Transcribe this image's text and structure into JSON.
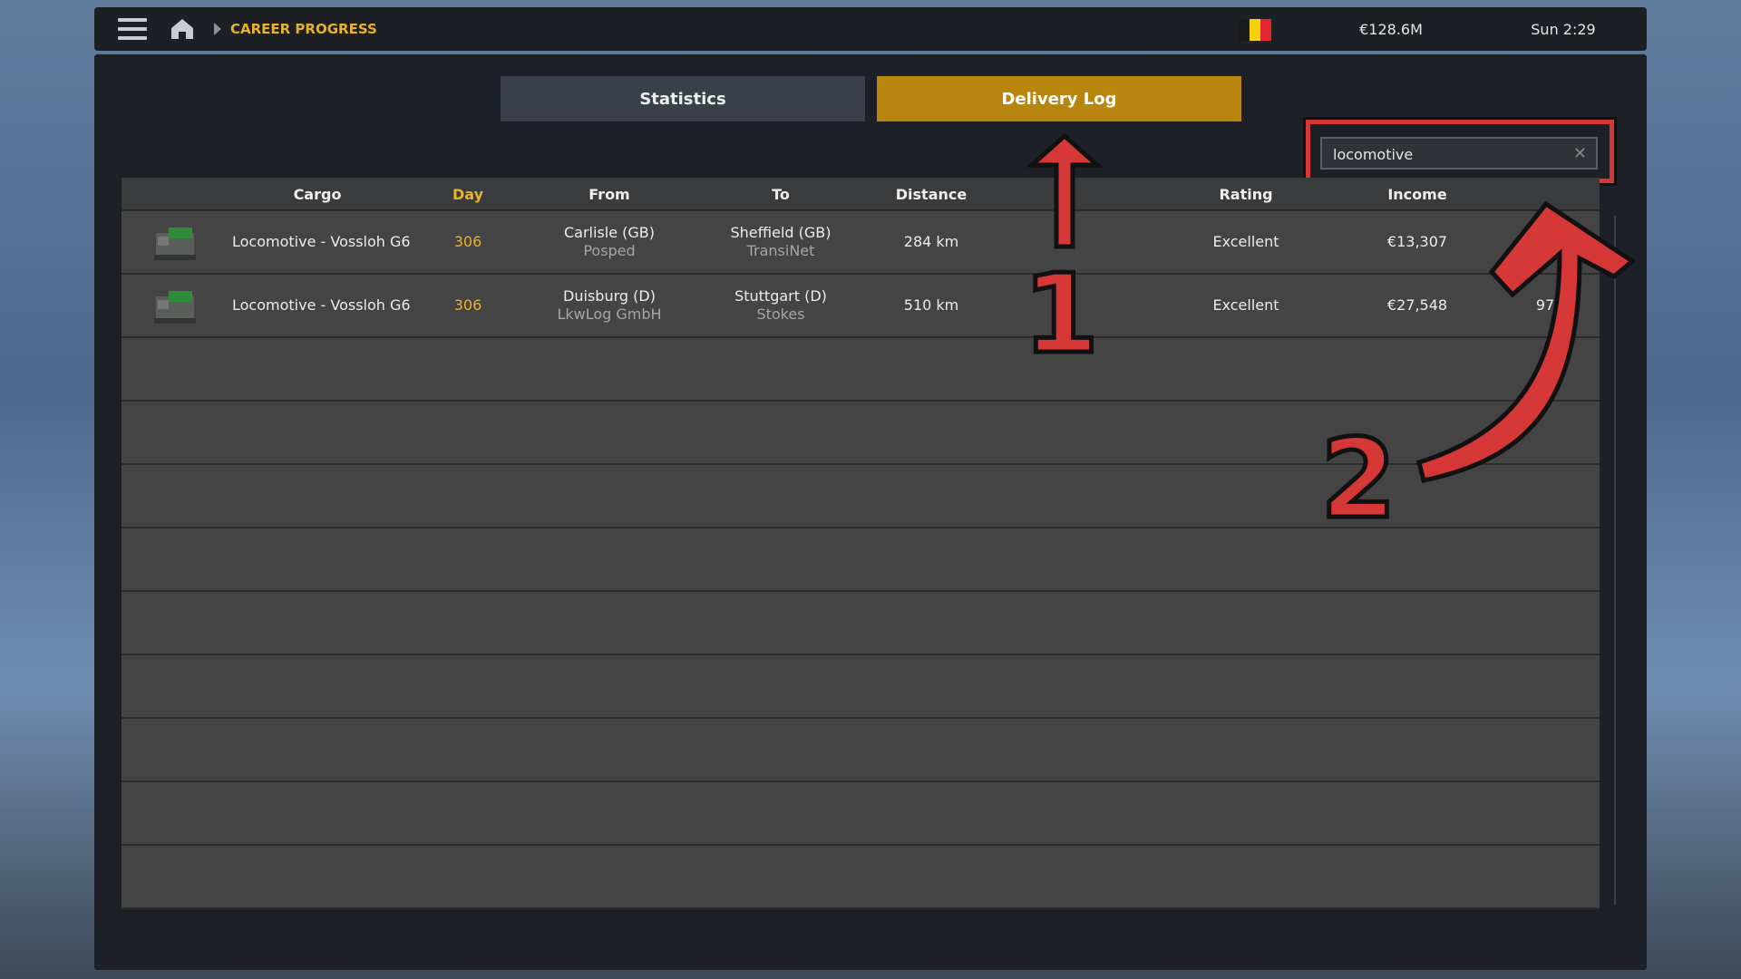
{
  "topbar": {
    "breadcrumb": "CAREER PROGRESS",
    "money": "€128.6M",
    "time": "Sun 2:29",
    "flag_colors": [
      "#1a1a1a",
      "#f5d10a",
      "#e3262f"
    ]
  },
  "tabs": [
    {
      "label": "Statistics",
      "active": false
    },
    {
      "label": "Delivery Log",
      "active": true
    }
  ],
  "search": {
    "value": "locomotive"
  },
  "table": {
    "headers": [
      "Cargo",
      "Day",
      "From",
      "To",
      "Distance",
      "Rating",
      "Income"
    ],
    "rows": [
      {
        "cargo": "Locomotive - Vossloh G6",
        "day": "306",
        "from": "Carlisle (GB)",
        "from_company": "Posped",
        "to": "Sheffield (GB)",
        "to_company": "TransiNet",
        "distance": "284 km",
        "rating": "Excellent",
        "income": "€13,307",
        "extra": ""
      },
      {
        "cargo": "Locomotive - Vossloh G6",
        "day": "306",
        "from": "Duisburg (D)",
        "from_company": "LkwLog GmbH",
        "to": "Stuttgart (D)",
        "to_company": "Stokes",
        "distance": "510 km",
        "rating": "Excellent",
        "income": "€27,548",
        "extra": "97"
      }
    ]
  },
  "annotations": {
    "label_1": "1",
    "label_2": "2",
    "color": "#d63838"
  },
  "colors": {
    "accent": "#b8860f",
    "highlight": "#e8b22a"
  }
}
